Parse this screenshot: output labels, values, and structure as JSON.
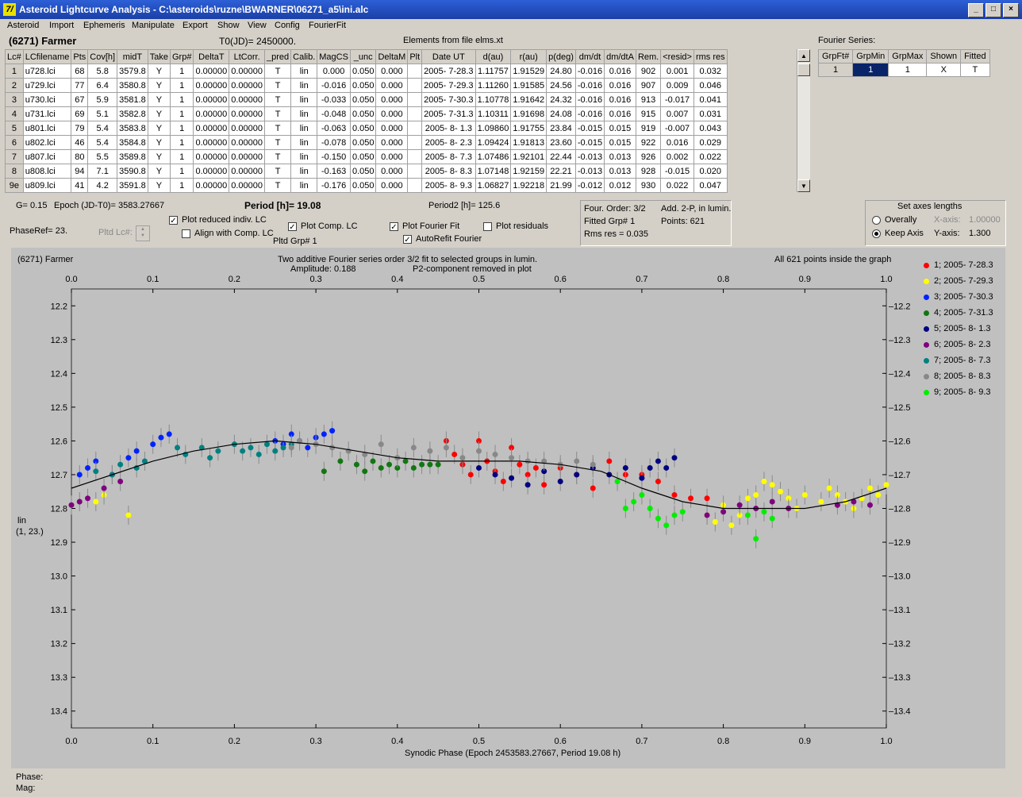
{
  "window": {
    "title": "Asteroid Lightcurve Analysis - C:\\asteroids\\ruzne\\BWARNER\\06271_a5\\ini.alc",
    "app_icon": "7/",
    "min": "_",
    "max": "□",
    "close": "×"
  },
  "menu": [
    "Asteroid",
    "Import",
    "Ephemeris",
    "Manipulate",
    "Export",
    "Show",
    "View",
    "Config",
    "FourierFit"
  ],
  "header": {
    "object": "(6271) Farmer",
    "t0": "T0(JD)= 2450000.",
    "elements": "Elements from file elms.xt"
  },
  "table": {
    "columns": [
      "Lc#",
      "LCfilename",
      "Pts",
      "Cov[h]",
      "midT",
      "Take",
      "Grp#",
      "DeltaT",
      "LtCorr.",
      "_pred",
      "Calib.",
      "MagCS",
      "_unc",
      "DeltaM",
      "Plt",
      "Date UT",
      "d(au)",
      "r(au)",
      "p(deg)",
      "dm/dt",
      "dm/dtA",
      "Rem.",
      "<resid>",
      "rms res"
    ],
    "rows": [
      [
        "1",
        "u728.lci",
        "68",
        "5.8",
        "3579.8",
        "Y",
        "1",
        "0.00000",
        "0.00000",
        "T",
        "lin",
        "0.000",
        "0.050",
        "0.000",
        "",
        "2005- 7-28.3",
        "1.11757",
        "1.91529",
        "24.80",
        "-0.016",
        "0.016",
        "902",
        "0.001",
        "0.032"
      ],
      [
        "2",
        "u729.lci",
        "77",
        "6.4",
        "3580.8",
        "Y",
        "1",
        "0.00000",
        "0.00000",
        "T",
        "lin",
        "-0.016",
        "0.050",
        "0.000",
        "",
        "2005- 7-29.3",
        "1.11260",
        "1.91585",
        "24.56",
        "-0.016",
        "0.016",
        "907",
        "0.009",
        "0.046"
      ],
      [
        "3",
        "u730.lci",
        "67",
        "5.9",
        "3581.8",
        "Y",
        "1",
        "0.00000",
        "0.00000",
        "T",
        "lin",
        "-0.033",
        "0.050",
        "0.000",
        "",
        "2005- 7-30.3",
        "1.10778",
        "1.91642",
        "24.32",
        "-0.016",
        "0.016",
        "913",
        "-0.017",
        "0.041"
      ],
      [
        "4",
        "u731.lci",
        "69",
        "5.1",
        "3582.8",
        "Y",
        "1",
        "0.00000",
        "0.00000",
        "T",
        "lin",
        "-0.048",
        "0.050",
        "0.000",
        "",
        "2005- 7-31.3",
        "1.10311",
        "1.91698",
        "24.08",
        "-0.016",
        "0.016",
        "915",
        "0.007",
        "0.031"
      ],
      [
        "5",
        "u801.lci",
        "79",
        "5.4",
        "3583.8",
        "Y",
        "1",
        "0.00000",
        "0.00000",
        "T",
        "lin",
        "-0.063",
        "0.050",
        "0.000",
        "",
        "2005- 8- 1.3",
        "1.09860",
        "1.91755",
        "23.84",
        "-0.015",
        "0.015",
        "919",
        "-0.007",
        "0.043"
      ],
      [
        "6",
        "u802.lci",
        "46",
        "5.4",
        "3584.8",
        "Y",
        "1",
        "0.00000",
        "0.00000",
        "T",
        "lin",
        "-0.078",
        "0.050",
        "0.000",
        "",
        "2005- 8- 2.3",
        "1.09424",
        "1.91813",
        "23.60",
        "-0.015",
        "0.015",
        "922",
        "0.016",
        "0.029"
      ],
      [
        "7",
        "u807.lci",
        "80",
        "5.5",
        "3589.8",
        "Y",
        "1",
        "0.00000",
        "0.00000",
        "T",
        "lin",
        "-0.150",
        "0.050",
        "0.000",
        "",
        "2005- 8- 7.3",
        "1.07486",
        "1.92101",
        "22.44",
        "-0.013",
        "0.013",
        "926",
        "0.002",
        "0.022"
      ],
      [
        "8",
        "u808.lci",
        "94",
        "7.1",
        "3590.8",
        "Y",
        "1",
        "0.00000",
        "0.00000",
        "T",
        "lin",
        "-0.163",
        "0.050",
        "0.000",
        "",
        "2005- 8- 8.3",
        "1.07148",
        "1.92159",
        "22.21",
        "-0.013",
        "0.013",
        "928",
        "-0.015",
        "0.020"
      ],
      [
        "9e",
        "u809.lci",
        "41",
        "4.2",
        "3591.8",
        "Y",
        "1",
        "0.00000",
        "0.00000",
        "T",
        "lin",
        "-0.176",
        "0.050",
        "0.000",
        "",
        "2005- 8- 9.3",
        "1.06827",
        "1.92218",
        "21.99",
        "-0.012",
        "0.012",
        "930",
        "0.022",
        "0.047"
      ]
    ]
  },
  "fourier": {
    "label": "Fourier Series:",
    "columns": [
      "GrpFt#",
      "GrpMin",
      "GrpMax",
      "Shown",
      "Fitted"
    ],
    "row": [
      "1",
      "1",
      "1",
      "X",
      "T"
    ]
  },
  "params": {
    "g": "G= 0.15",
    "epoch": "Epoch (JD-T0)= 3583.27667",
    "period": "Period [h]= 19.08",
    "period2": "Period2 [h]= 125.6",
    "phaseref": "PhaseRef= 23.",
    "pltd_lc": "Pltd Lc#:",
    "pltd_grp": "Pltd Grp#  1",
    "cb_reduced": "Plot reduced indiv. LC",
    "cb_align": "Align with Comp. LC",
    "cb_comp": "Plot Comp. LC",
    "cb_fourier": "Plot Fourier Fit",
    "cb_autorefit": "AutoRefit Fourier",
    "cb_resid": "Plot residuals",
    "four_order": "Four. Order:  3/2",
    "add2p": "Add. 2-P, in lumin.",
    "fitted_grp": "Fitted Grp# 1",
    "points": "Points: 621",
    "rms": "Rms res      = 0.035"
  },
  "axes_box": {
    "title": "Set axes lengths",
    "overally": "Overally",
    "keep": "Keep Axis",
    "xaxis_label": "X-axis:",
    "xaxis_val": "1.00000",
    "yaxis_label": "Y-axis:",
    "yaxis_val": "1.300"
  },
  "plot": {
    "name": "(6271) Farmer",
    "line1": "Two additive Fourier series order 3/2 fit to selected groups in lumin.",
    "line2a": "Amplitude: 0.188",
    "line2b": "P2-component removed in plot",
    "right_note": "All 621 points inside the graph",
    "side1": "lin",
    "side2": "(1, 23.)",
    "xlabel": "Synodic Phase (Epoch 2453583.27667, Period 19.08 h)",
    "phase": "Phase:",
    "mag": "Mag:"
  },
  "chart_data": {
    "type": "scatter",
    "x_ticks": [
      "0.0",
      "0.1",
      "0.2",
      "0.3",
      "0.4",
      "0.5",
      "0.6",
      "0.7",
      "0.8",
      "0.9",
      "1.0"
    ],
    "y_ticks": [
      "12.2",
      "12.3",
      "12.4",
      "12.5",
      "12.6",
      "12.7",
      "12.8",
      "12.9",
      "13.0",
      "13.1",
      "13.2",
      "13.3",
      "13.4"
    ],
    "xlim": [
      0,
      1
    ],
    "ylim": [
      12.15,
      13.45
    ],
    "y_inverted": true,
    "fit_curve": {
      "x": [
        0,
        0.05,
        0.1,
        0.15,
        0.2,
        0.25,
        0.3,
        0.35,
        0.4,
        0.45,
        0.5,
        0.55,
        0.6,
        0.65,
        0.7,
        0.75,
        0.8,
        0.85,
        0.9,
        0.95,
        1.0
      ],
      "y": [
        12.74,
        12.7,
        12.66,
        12.63,
        12.61,
        12.6,
        12.61,
        12.63,
        12.65,
        12.66,
        12.66,
        12.66,
        12.67,
        12.69,
        12.74,
        12.78,
        12.8,
        12.8,
        12.8,
        12.78,
        12.74
      ]
    },
    "series": [
      {
        "name": "1; 2005- 7-28.3",
        "color": "#ff0000",
        "x": [
          0.46,
          0.47,
          0.48,
          0.49,
          0.5,
          0.51,
          0.52,
          0.53,
          0.54,
          0.55,
          0.56,
          0.57,
          0.58,
          0.6,
          0.62,
          0.64,
          0.66,
          0.68,
          0.7,
          0.72,
          0.74,
          0.76,
          0.78
        ],
        "y": [
          12.6,
          12.64,
          12.67,
          12.7,
          12.6,
          12.66,
          12.69,
          12.72,
          12.62,
          12.67,
          12.7,
          12.68,
          12.73,
          12.68,
          12.7,
          12.74,
          12.66,
          12.7,
          12.7,
          12.72,
          12.76,
          12.77,
          12.77
        ]
      },
      {
        "name": "2; 2005- 7-29.3",
        "color": "#ffff00",
        "x": [
          0.03,
          0.04,
          0.07,
          0.78,
          0.79,
          0.8,
          0.81,
          0.82,
          0.83,
          0.84,
          0.85,
          0.86,
          0.87,
          0.88,
          0.89,
          0.9,
          0.92,
          0.93,
          0.94,
          0.95,
          0.96,
          0.97,
          0.98,
          0.99,
          1.0
        ],
        "y": [
          12.78,
          12.76,
          12.82,
          12.82,
          12.84,
          12.79,
          12.85,
          12.82,
          12.77,
          12.76,
          12.72,
          12.73,
          12.75,
          12.77,
          12.8,
          12.76,
          12.78,
          12.74,
          12.76,
          12.78,
          12.8,
          12.77,
          12.74,
          12.76,
          12.73
        ]
      },
      {
        "name": "3; 2005- 7-30.3",
        "color": "#0022ff",
        "x": [
          0.01,
          0.02,
          0.03,
          0.05,
          0.07,
          0.08,
          0.1,
          0.11,
          0.12,
          0.25,
          0.26,
          0.27,
          0.28,
          0.29,
          0.3,
          0.31,
          0.32
        ],
        "y": [
          12.7,
          12.68,
          12.66,
          12.7,
          12.65,
          12.63,
          12.61,
          12.59,
          12.58,
          12.6,
          12.61,
          12.58,
          12.6,
          12.62,
          12.59,
          12.58,
          12.57
        ]
      },
      {
        "name": "4; 2005- 7-31.3",
        "color": "#117711",
        "x": [
          0.31,
          0.33,
          0.35,
          0.36,
          0.37,
          0.38,
          0.39,
          0.4,
          0.41,
          0.42,
          0.43,
          0.44,
          0.45
        ],
        "y": [
          12.69,
          12.66,
          12.67,
          12.69,
          12.66,
          12.68,
          12.67,
          12.68,
          12.66,
          12.68,
          12.67,
          12.67,
          12.67
        ]
      },
      {
        "name": "5; 2005- 8- 1.3",
        "color": "#000080",
        "x": [
          0.5,
          0.52,
          0.54,
          0.56,
          0.58,
          0.6,
          0.62,
          0.64,
          0.66,
          0.68,
          0.7,
          0.71,
          0.72,
          0.73,
          0.74
        ],
        "y": [
          12.68,
          12.7,
          12.71,
          12.73,
          12.69,
          12.72,
          12.7,
          12.68,
          12.7,
          12.68,
          12.71,
          12.68,
          12.66,
          12.68,
          12.65
        ]
      },
      {
        "name": "6; 2005- 8- 2.3",
        "color": "#800080",
        "x": [
          0.0,
          0.01,
          0.02,
          0.04,
          0.06,
          0.78,
          0.8,
          0.82,
          0.84,
          0.86,
          0.88,
          0.94,
          0.96,
          0.98
        ],
        "y": [
          12.79,
          12.78,
          12.77,
          12.74,
          12.72,
          12.82,
          12.81,
          12.79,
          12.8,
          12.78,
          12.8,
          12.79,
          12.78,
          12.79
        ]
      },
      {
        "name": "7; 2005- 8- 7.3",
        "color": "#008080",
        "x": [
          0.03,
          0.05,
          0.06,
          0.08,
          0.09,
          0.13,
          0.14,
          0.16,
          0.17,
          0.18,
          0.2,
          0.21,
          0.22,
          0.23,
          0.24,
          0.25,
          0.26,
          0.27
        ],
        "y": [
          12.69,
          12.7,
          12.67,
          12.68,
          12.66,
          12.62,
          12.64,
          12.62,
          12.65,
          12.63,
          12.61,
          12.63,
          12.62,
          12.64,
          12.61,
          12.63,
          12.62,
          12.61
        ]
      },
      {
        "name": "8; 2005- 8- 8.3",
        "color": "#888888",
        "x": [
          0.27,
          0.28,
          0.3,
          0.32,
          0.34,
          0.36,
          0.38,
          0.4,
          0.42,
          0.44,
          0.46,
          0.48,
          0.5,
          0.52,
          0.54,
          0.56,
          0.58,
          0.6,
          0.62,
          0.64
        ],
        "y": [
          12.62,
          12.6,
          12.61,
          12.62,
          12.63,
          12.64,
          12.61,
          12.65,
          12.62,
          12.63,
          12.62,
          12.65,
          12.63,
          12.64,
          12.65,
          12.66,
          12.66,
          12.67,
          12.66,
          12.67
        ]
      },
      {
        "name": "9; 2005- 8- 9.3",
        "color": "#00ee00",
        "x": [
          0.67,
          0.68,
          0.69,
          0.7,
          0.71,
          0.72,
          0.73,
          0.74,
          0.75,
          0.83,
          0.84,
          0.85,
          0.86
        ],
        "y": [
          12.72,
          12.8,
          12.78,
          12.76,
          12.8,
          12.83,
          12.85,
          12.82,
          12.81,
          12.82,
          12.89,
          12.81,
          12.83
        ]
      }
    ]
  }
}
